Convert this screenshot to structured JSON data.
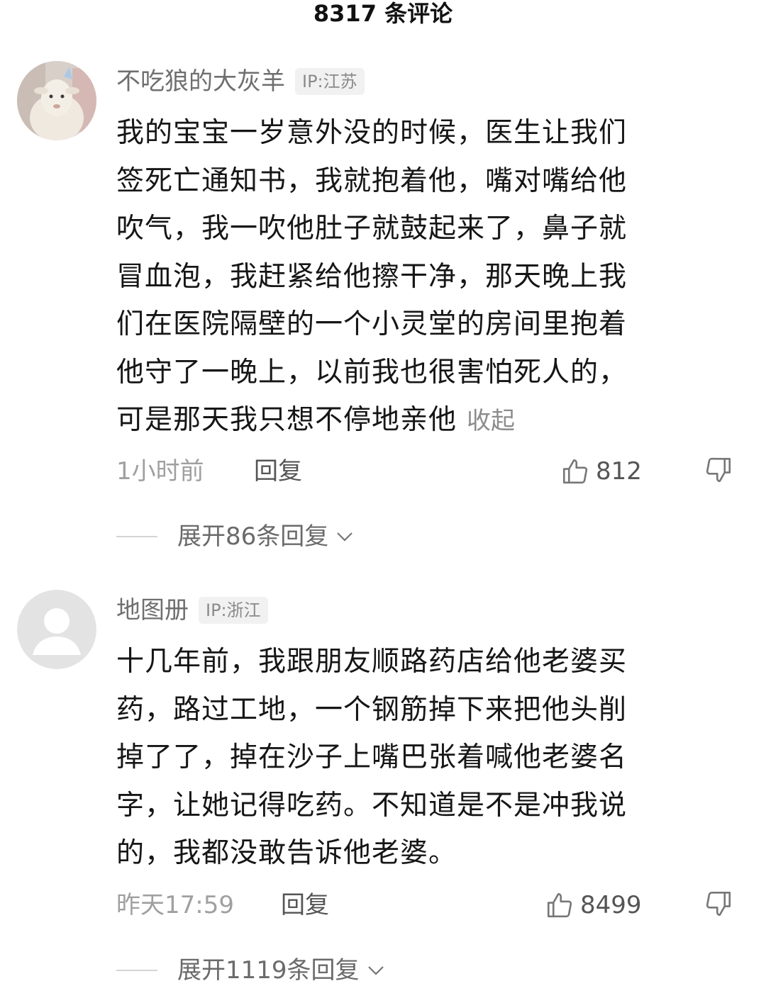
{
  "header": {
    "title": "8317 条评论"
  },
  "comments": [
    {
      "username": "不吃狼的大灰羊",
      "ip": "IP:江苏",
      "lines": [
        "我的宝宝一岁意外没的时候，医生让我们",
        "签死亡通知书，我就抱着他，嘴对嘴给他",
        "吹气，我一吹他肚子就鼓起来了，鼻子就",
        "冒血泡，我赶紧给他擦干净，那天晚上我",
        "们在医院隔壁的一个小灵堂的房间里抱着",
        "他守了一晚上，以前我也很害怕死人的，",
        "可是那天我只想不停地亲他"
      ],
      "collapse_label": "收起",
      "time": "1小时前",
      "reply_label": "回复",
      "likes": "812",
      "expand_label": "展开86条回复"
    },
    {
      "username": "地图册",
      "ip": "IP:浙江",
      "lines": [
        "十几年前，我跟朋友顺路药店给他老婆买",
        "药，路过工地，一个钢筋掉下来把他头削",
        "掉了了，掉在沙子上嘴巴张着喊他老婆名",
        "字，让她记得吃药。不知道是不是冲我说",
        "的，我都没敢告诉他老婆。"
      ],
      "time": "昨天17:59",
      "reply_label": "回复",
      "likes": "8499",
      "expand_label": "展开1119条回复"
    }
  ],
  "icons": {
    "like": "thumb-up-icon",
    "dislike": "thumb-down-icon",
    "expand": "chevron-down-icon"
  },
  "colors": {
    "text": "#161616",
    "muted": "#8c8c8c",
    "ip_tag_bg": "#f1f1f1"
  }
}
